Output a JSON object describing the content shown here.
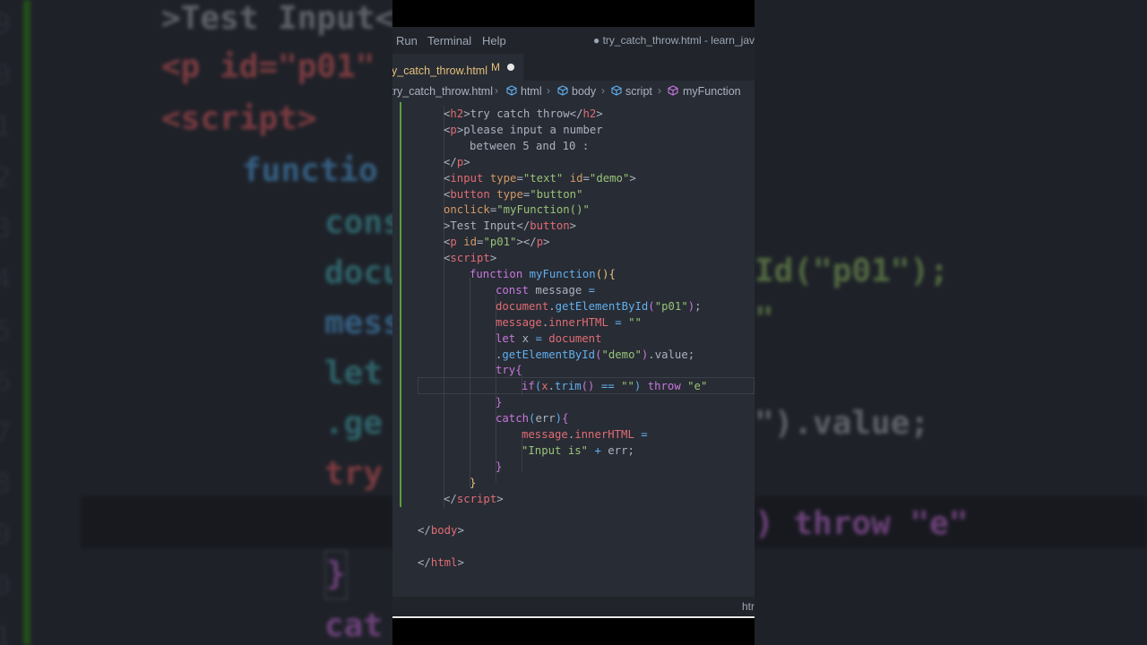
{
  "menu": {
    "run": "Run",
    "terminal": "Terminal",
    "help": "Help"
  },
  "window_title": "● try_catch_throw.html - learn_javasc",
  "tab": {
    "name": "try_catch_throw.html",
    "status": "M"
  },
  "breadcrumb": [
    "try_catch_throw.html",
    "html",
    "body",
    "script",
    "myFunction"
  ],
  "status_bar": {
    "language": "htr"
  },
  "code": [
    {
      "indent": 4,
      "tokens": [
        [
          "punc",
          "<"
        ],
        [
          "tag",
          "h2"
        ],
        [
          "punc",
          ">try catch throw</"
        ],
        [
          "tag",
          "h2"
        ],
        [
          "punc",
          ">"
        ]
      ]
    },
    {
      "indent": 4,
      "tokens": [
        [
          "punc",
          "<"
        ],
        [
          "tag",
          "p"
        ],
        [
          "punc",
          ">please input a number"
        ]
      ]
    },
    {
      "indent": 8,
      "tokens": [
        [
          "t",
          "between 5 and 10 :"
        ]
      ]
    },
    {
      "indent": 4,
      "tokens": [
        [
          "punc",
          "</"
        ],
        [
          "tag",
          "p"
        ],
        [
          "punc",
          ">"
        ]
      ]
    },
    {
      "indent": 4,
      "tokens": [
        [
          "punc",
          "<"
        ],
        [
          "tag",
          "input"
        ],
        [
          "t",
          " "
        ],
        [
          "attr",
          "type"
        ],
        [
          "t",
          "="
        ],
        [
          "str",
          "\"text\""
        ],
        [
          "t",
          " "
        ],
        [
          "attr",
          "id"
        ],
        [
          "t",
          "="
        ],
        [
          "str",
          "\"demo\""
        ],
        [
          "punc",
          ">"
        ]
      ]
    },
    {
      "indent": 4,
      "tokens": [
        [
          "punc",
          "<"
        ],
        [
          "tag",
          "button"
        ],
        [
          "t",
          " "
        ],
        [
          "attr",
          "type"
        ],
        [
          "t",
          "="
        ],
        [
          "str",
          "\"button\""
        ]
      ]
    },
    {
      "indent": 4,
      "tokens": [
        [
          "attr",
          "onclick"
        ],
        [
          "t",
          "="
        ],
        [
          "str",
          "\"myFunction()\""
        ]
      ]
    },
    {
      "indent": 4,
      "tokens": [
        [
          "punc",
          ">Test Input</"
        ],
        [
          "tag",
          "button"
        ],
        [
          "punc",
          ">"
        ]
      ]
    },
    {
      "indent": 4,
      "tokens": [
        [
          "punc",
          "<"
        ],
        [
          "tag",
          "p"
        ],
        [
          "t",
          " "
        ],
        [
          "attr",
          "id"
        ],
        [
          "t",
          "="
        ],
        [
          "str",
          "\"p01\""
        ],
        [
          "punc",
          "></"
        ],
        [
          "tag",
          "p"
        ],
        [
          "punc",
          ">"
        ]
      ]
    },
    {
      "indent": 4,
      "tokens": [
        [
          "punc",
          "<"
        ],
        [
          "tag",
          "script"
        ],
        [
          "punc",
          ">"
        ]
      ]
    },
    {
      "indent": 8,
      "tokens": [
        [
          "kw",
          "function"
        ],
        [
          "t",
          " "
        ],
        [
          "fn",
          "myFunction"
        ],
        [
          "yb",
          "(){"
        ]
      ]
    },
    {
      "indent": 12,
      "tokens": [
        [
          "kw",
          "const"
        ],
        [
          "t",
          " message "
        ],
        [
          "fn",
          "="
        ]
      ]
    },
    {
      "indent": 12,
      "tokens": [
        [
          "id",
          "document"
        ],
        [
          "t",
          "."
        ],
        [
          "fn",
          "getElementById"
        ],
        [
          "kw",
          "("
        ],
        [
          "str",
          "\"p01\""
        ],
        [
          "kw",
          ")"
        ],
        [
          "t",
          ";"
        ]
      ]
    },
    {
      "indent": 12,
      "tokens": [
        [
          "id",
          "message"
        ],
        [
          "t",
          "."
        ],
        [
          "id",
          "innerHTML"
        ],
        [
          "t",
          " "
        ],
        [
          "fn",
          "="
        ],
        [
          "t",
          " "
        ],
        [
          "str",
          "\"\""
        ]
      ]
    },
    {
      "indent": 12,
      "tokens": [
        [
          "kw",
          "let"
        ],
        [
          "t",
          " x "
        ],
        [
          "fn",
          "="
        ],
        [
          "t",
          " "
        ],
        [
          "id",
          "document"
        ]
      ]
    },
    {
      "indent": 12,
      "tokens": [
        [
          "t",
          "."
        ],
        [
          "fn",
          "getElementById"
        ],
        [
          "kw",
          "("
        ],
        [
          "str",
          "\"demo\""
        ],
        [
          "kw",
          ")"
        ],
        [
          "t",
          ".value;"
        ]
      ]
    },
    {
      "indent": 12,
      "tokens": [
        [
          "kw",
          "try"
        ],
        [
          "kw",
          "{"
        ]
      ]
    },
    {
      "indent": 16,
      "tokens": [
        [
          "kw",
          "if"
        ],
        [
          "fn",
          "("
        ],
        [
          "id",
          "x"
        ],
        [
          "t",
          "."
        ],
        [
          "fn",
          "trim"
        ],
        [
          "kw",
          "()"
        ],
        [
          "t",
          " "
        ],
        [
          "fn",
          "=="
        ],
        [
          "t",
          " "
        ],
        [
          "str",
          "\"\""
        ],
        [
          "fn",
          ")"
        ],
        [
          "t",
          " "
        ],
        [
          "kw",
          "throw"
        ],
        [
          "t",
          " "
        ],
        [
          "str",
          "\"e\""
        ]
      ]
    },
    {
      "indent": 12,
      "tokens": [
        [
          "kw",
          "}"
        ]
      ]
    },
    {
      "indent": 12,
      "tokens": [
        [
          "kw",
          "catch"
        ],
        [
          "fn",
          "("
        ],
        [
          "t",
          "err"
        ],
        [
          "fn",
          ")"
        ],
        [
          "kw",
          "{"
        ]
      ]
    },
    {
      "indent": 16,
      "tokens": [
        [
          "id",
          "message"
        ],
        [
          "t",
          "."
        ],
        [
          "id",
          "innerHTML"
        ],
        [
          "t",
          " "
        ],
        [
          "fn",
          "="
        ]
      ]
    },
    {
      "indent": 16,
      "tokens": [
        [
          "str",
          "\"Input is\""
        ],
        [
          "t",
          " "
        ],
        [
          "fn",
          "+"
        ],
        [
          "t",
          " err;"
        ]
      ]
    },
    {
      "indent": 12,
      "tokens": [
        [
          "kw",
          "}"
        ]
      ]
    },
    {
      "indent": 8,
      "tokens": [
        [
          "yb",
          "}"
        ]
      ]
    },
    {
      "indent": 4,
      "tokens": [
        [
          "punc",
          "</"
        ],
        [
          "tag",
          "script"
        ],
        [
          "punc",
          ">"
        ]
      ]
    },
    {
      "indent": 0,
      "tokens": []
    },
    {
      "indent": 0,
      "tokens": [
        [
          "punc",
          "</"
        ],
        [
          "tag",
          "body"
        ],
        [
          "punc",
          ">"
        ]
      ]
    },
    {
      "indent": 0,
      "tokens": []
    },
    {
      "indent": 0,
      "tokens": [
        [
          "punc",
          "</"
        ],
        [
          "tag",
          "html"
        ],
        [
          "punc",
          ">"
        ]
      ]
    }
  ],
  "background_left": {
    "lines": [
      ">Test Input<",
      "<p id=\"p01\"",
      "<script>",
      "functio",
      "cons",
      "docu",
      "mess",
      "let",
      ".ge",
      "try",
      "}",
      "cat"
    ],
    "gutter": [
      "9",
      "0",
      "1",
      "2",
      "3",
      "4",
      "5",
      "6",
      "7",
      "8",
      "9",
      "0",
      "1"
    ]
  },
  "background_right": {
    "lines": [
      "Id(\"p01\");",
      "\"",
      "\").value;",
      ") throw \"e\""
    ]
  }
}
